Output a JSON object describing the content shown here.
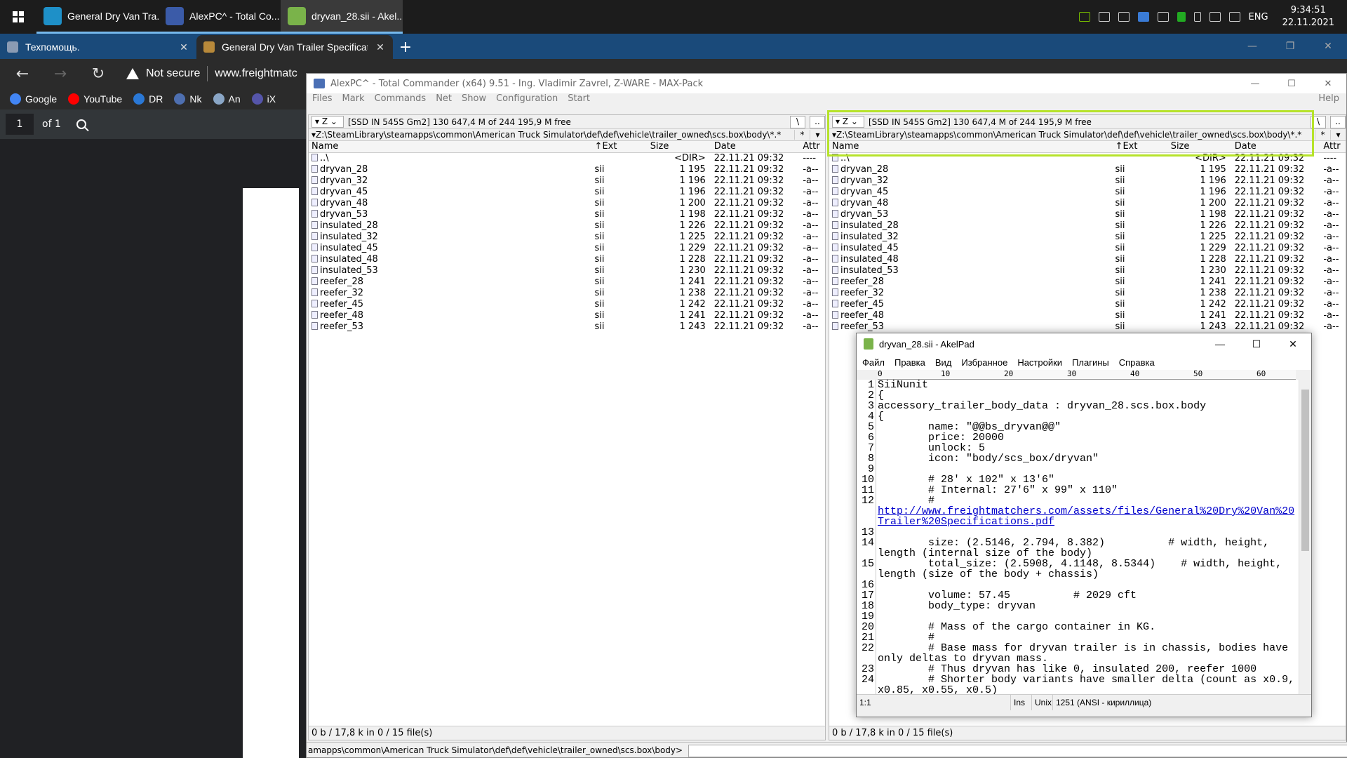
{
  "taskbar": {
    "tasks": [
      {
        "label": "General Dry Van Tra...",
        "color": "#1e90c8"
      },
      {
        "label": "AlexPC^ - Total Co...",
        "color": "#3b5ba8"
      },
      {
        "label": "dryvan_28.sii - Akel...",
        "color": "#7ab34a"
      }
    ],
    "tray_lang": "ENG",
    "time": "9:34:51",
    "date": "22.11.2021"
  },
  "browser": {
    "tabs": [
      {
        "label": "Техпомощь."
      },
      {
        "label": "General Dry Van Trailer Specificat"
      }
    ],
    "security_label": "Not secure",
    "url": "www.freightmatc",
    "bookmarks": [
      {
        "label": "Google",
        "color": "#4285f4"
      },
      {
        "label": "YouTube",
        "color": "#ff0000"
      },
      {
        "label": "DR",
        "color": "#2a78d6"
      },
      {
        "label": "Nk",
        "color": "#4e6fb0"
      },
      {
        "label": "An",
        "color": "#8aa6c6"
      },
      {
        "label": "iX",
        "color": "#5555aa"
      }
    ],
    "pdf": {
      "page": "1",
      "of": "of 1"
    }
  },
  "tc": {
    "title": "AlexPC^ - Total Commander (x64) 9.51 - Ing. Vladimir Zavrel, Z-WARE - MAX-Pack",
    "menu": [
      "Files",
      "Mark",
      "Commands",
      "Net",
      "Show",
      "Configuration",
      "Start"
    ],
    "help": "Help",
    "drive": "Z",
    "drive_info": "[SSD IN 545S Gm2]  130 647,4 M of 244 195,9 M free",
    "path": "Z:\\SteamLibrary\\steamapps\\common\\American Truck Simulator\\def\\def\\vehicle\\trailer_owned\\scs.box\\body\\*.*",
    "columns": {
      "name": "Name",
      "ext": "Ext",
      "size": "Size",
      "date": "Date",
      "attr": "Attr"
    },
    "parent": {
      "name": "..\\",
      "size": "<DIR>",
      "date": "22.11.21 09:32",
      "attr": "----"
    },
    "files": [
      {
        "name": "dryvan_28",
        "ext": "sii",
        "size": "1 195",
        "date": "22.11.21 09:32",
        "attr": "-a--"
      },
      {
        "name": "dryvan_32",
        "ext": "sii",
        "size": "1 196",
        "date": "22.11.21 09:32",
        "attr": "-a--"
      },
      {
        "name": "dryvan_45",
        "ext": "sii",
        "size": "1 196",
        "date": "22.11.21 09:32",
        "attr": "-a--"
      },
      {
        "name": "dryvan_48",
        "ext": "sii",
        "size": "1 200",
        "date": "22.11.21 09:32",
        "attr": "-a--"
      },
      {
        "name": "dryvan_53",
        "ext": "sii",
        "size": "1 198",
        "date": "22.11.21 09:32",
        "attr": "-a--"
      },
      {
        "name": "insulated_28",
        "ext": "sii",
        "size": "1 226",
        "date": "22.11.21 09:32",
        "attr": "-a--"
      },
      {
        "name": "insulated_32",
        "ext": "sii",
        "size": "1 225",
        "date": "22.11.21 09:32",
        "attr": "-a--"
      },
      {
        "name": "insulated_45",
        "ext": "sii",
        "size": "1 229",
        "date": "22.11.21 09:32",
        "attr": "-a--"
      },
      {
        "name": "insulated_48",
        "ext": "sii",
        "size": "1 228",
        "date": "22.11.21 09:32",
        "attr": "-a--"
      },
      {
        "name": "insulated_53",
        "ext": "sii",
        "size": "1 230",
        "date": "22.11.21 09:32",
        "attr": "-a--"
      },
      {
        "name": "reefer_28",
        "ext": "sii",
        "size": "1 241",
        "date": "22.11.21 09:32",
        "attr": "-a--"
      },
      {
        "name": "reefer_32",
        "ext": "sii",
        "size": "1 238",
        "date": "22.11.21 09:32",
        "attr": "-a--"
      },
      {
        "name": "reefer_45",
        "ext": "sii",
        "size": "1 242",
        "date": "22.11.21 09:32",
        "attr": "-a--"
      },
      {
        "name": "reefer_48",
        "ext": "sii",
        "size": "1 241",
        "date": "22.11.21 09:32",
        "attr": "-a--"
      },
      {
        "name": "reefer_53",
        "ext": "sii",
        "size": "1 243",
        "date": "22.11.21 09:32",
        "attr": "-a--"
      }
    ],
    "status": "0 b / 17,8 k in 0 / 15 file(s)",
    "cmd_path": "amapps\\common\\American Truck Simulator\\def\\def\\vehicle\\trailer_owned\\scs.box\\body>"
  },
  "akel": {
    "title": "dryvan_28.sii - AkelPad",
    "menu": [
      "Файл",
      "Правка",
      "Вид",
      "Избранное",
      "Настройки",
      "Плагины",
      "Справка"
    ],
    "ruler": [
      "0",
      "10",
      "20",
      "30",
      "40",
      "50",
      "60"
    ],
    "lines": [
      {
        "n": "1",
        "t": "SiiNunit"
      },
      {
        "n": "2",
        "t": "{"
      },
      {
        "n": "3",
        "t": "accessory_trailer_body_data : dryvan_28.scs.box.body"
      },
      {
        "n": "4",
        "t": "{"
      },
      {
        "n": "5",
        "t": "        name: \"@@bs_dryvan@@\""
      },
      {
        "n": "6",
        "t": "        price: 20000"
      },
      {
        "n": "7",
        "t": "        unlock: 5"
      },
      {
        "n": "8",
        "t": "        icon: \"body/scs_box/dryvan\""
      },
      {
        "n": "9",
        "t": ""
      },
      {
        "n": "10",
        "t": "        # 28' x 102\" x 13'6\""
      },
      {
        "n": "11",
        "t": "        # Internal: 27'6\" x 99\" x 110\""
      },
      {
        "n": "12",
        "t": "        #"
      },
      {
        "n": "",
        "t": "http://www.freightmatchers.com/assets/files/General%20Dry%20Van%20Trailer%20Specifications.pdf",
        "link": true,
        "wrap": true
      },
      {
        "n": "13",
        "t": ""
      },
      {
        "n": "14",
        "t": "        size: (2.5146, 2.794, 8.382)          # width, height, length (internal size of the body)",
        "wrap": true
      },
      {
        "n": "15",
        "t": "        total_size: (2.5908, 4.1148, 8.5344)    # width, height, length (size of the body + chassis)",
        "wrap": true
      },
      {
        "n": "16",
        "t": ""
      },
      {
        "n": "17",
        "t": "        volume: 57.45          # 2029 cft"
      },
      {
        "n": "18",
        "t": "        body_type: dryvan"
      },
      {
        "n": "19",
        "t": ""
      },
      {
        "n": "20",
        "t": "        # Mass of the cargo container in KG."
      },
      {
        "n": "21",
        "t": "        #"
      },
      {
        "n": "22",
        "t": "        # Base mass for dryvan trailer is in chassis, bodies have only deltas to dryvan mass.",
        "wrap": true
      },
      {
        "n": "23",
        "t": "        # Thus dryvan has like 0, insulated 200, reefer 1000"
      },
      {
        "n": "24",
        "t": "        # Shorter body variants have smaller delta (count as x0.9, x0.85, x0.55, x0.5)",
        "wrap": true
      }
    ],
    "status": {
      "pos": "1:1",
      "mode": "Ins",
      "enc": "Unix",
      "codepage": "1251  (ANSI - кириллица)"
    }
  }
}
